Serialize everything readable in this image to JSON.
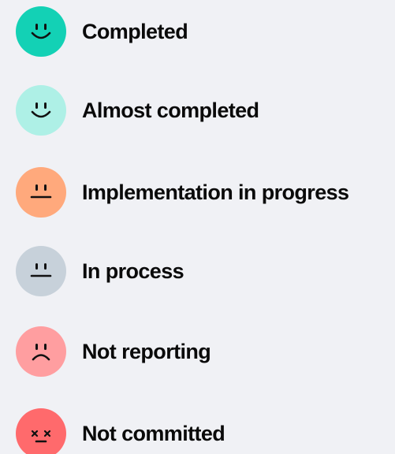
{
  "legend": {
    "items": [
      {
        "key": "completed",
        "label": "Completed",
        "color": "#13d1b5",
        "icon": "smiling-face-icon"
      },
      {
        "key": "almost-completed",
        "label": "Almost completed",
        "color": "#aef0e6",
        "icon": "smiling-face-icon"
      },
      {
        "key": "implementation-in-progress",
        "label": "Implementation in progress",
        "color": "#ffa97c",
        "icon": "neutral-face-icon"
      },
      {
        "key": "in-process",
        "label": "In process",
        "color": "#c7d1da",
        "icon": "neutral-face-icon"
      },
      {
        "key": "not-reporting",
        "label": "Not reporting",
        "color": "#ff9ea0",
        "icon": "frowning-face-icon"
      },
      {
        "key": "not-committed",
        "label": "Not committed",
        "color": "#ff6a6c",
        "icon": "dizzy-face-icon"
      }
    ]
  }
}
